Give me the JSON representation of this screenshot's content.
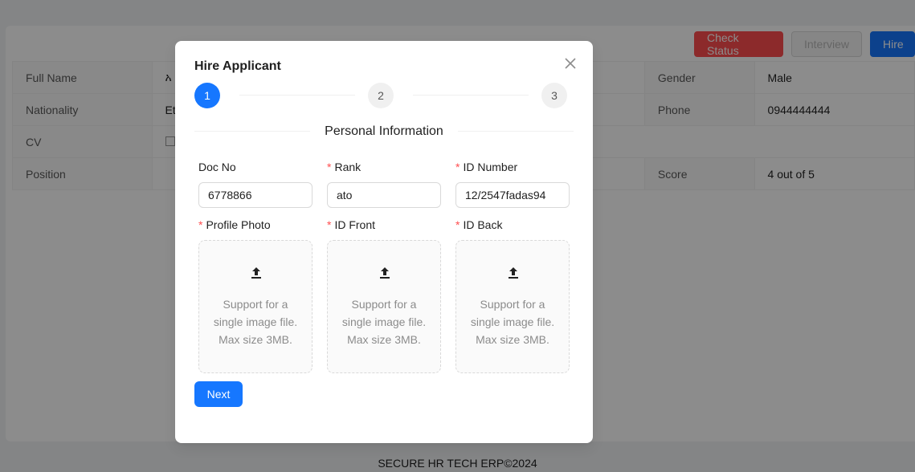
{
  "background": {
    "actions": {
      "check_status": "Check Status",
      "interview": "Interview",
      "hire": "Hire"
    },
    "details": {
      "rows": [
        {
          "label": "Full Name",
          "value": "አ",
          "label2": "Gender",
          "value2": "Male"
        },
        {
          "label": "Nationality",
          "value": "Et",
          "label2": "Phone",
          "value2": "0944444444"
        },
        {
          "label": "CV",
          "value": "",
          "label2": "",
          "value2": ""
        },
        {
          "label": "Position",
          "value": "",
          "label2": "Score",
          "value2": "4 out of 5"
        }
      ]
    },
    "footer": "SECURE HR TECH ERP©2024"
  },
  "modal": {
    "title": "Hire Applicant",
    "steps": [
      "1",
      "2",
      "3"
    ],
    "current_step": 1,
    "section_title": "Personal Information",
    "fields": {
      "doc_no": {
        "label": "Doc No",
        "value": "6778866",
        "required": false
      },
      "rank": {
        "label": "Rank",
        "value": "ato",
        "required": true
      },
      "id_number": {
        "label": "ID Number",
        "value": "12/2547fadas94",
        "required": true
      },
      "profile_photo": {
        "label": "Profile Photo",
        "required": true
      },
      "id_front": {
        "label": "ID Front",
        "required": true
      },
      "id_back": {
        "label": "ID Back",
        "required": true
      }
    },
    "upload_hint_lines": [
      "Support for a",
      "single image file.",
      "Max size 3MB."
    ],
    "upload_icon": "upload-icon",
    "next_label": "Next",
    "close_icon": "close-icon"
  },
  "colors": {
    "primary": "#1677ff",
    "danger": "#ff4d4f",
    "required": "#ff4d4f"
  }
}
